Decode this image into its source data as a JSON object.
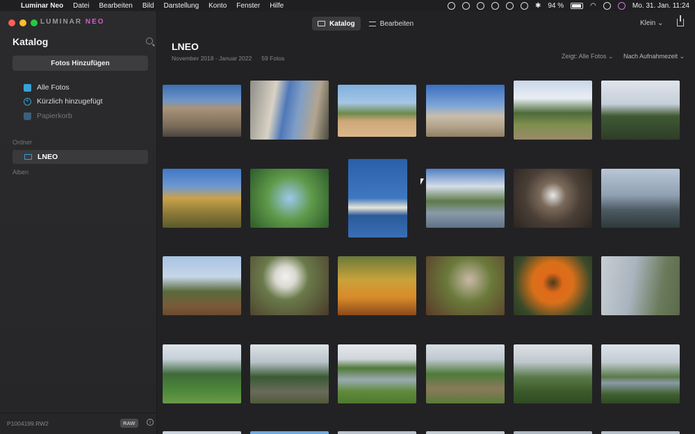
{
  "menubar": {
    "app": "Luminar Neo",
    "items": [
      "Datei",
      "Bearbeiten",
      "Bild",
      "Darstellung",
      "Konto",
      "Fenster",
      "Hilfe"
    ],
    "battery": "94 %",
    "datetime": "Mo. 31. Jan.  11:24"
  },
  "brand": {
    "name": "LUMINAR",
    "accent": "NEO"
  },
  "sidebar": {
    "title": "Katalog",
    "add_button": "Fotos Hinzufügen",
    "nav": [
      {
        "label": "Alle Fotos",
        "icon": "photos-icon"
      },
      {
        "label": "Kürzlich hinzugefügt",
        "icon": "recent-icon"
      },
      {
        "label": "Papierkorb",
        "icon": "trash-icon"
      }
    ],
    "folders_label": "Ordner",
    "folder": "LNEO",
    "albums_label": "Alben",
    "footer_filename": "P1004199.RW2",
    "footer_badge": "RAW"
  },
  "toolbar": {
    "tab_catalog": "Katalog",
    "tab_edit": "Bearbeiten",
    "size": "Klein ⌄"
  },
  "album": {
    "title": "LNEO",
    "daterange": "November 2018 - Januar 2022",
    "count": "59 Fotos",
    "filter": "Zeigt: Alle Fotos ⌄",
    "sort": "Nach Aufnahmezeit ⌄"
  },
  "colors": {
    "accent": "#3aa0d8",
    "neo": "#d35bd0"
  }
}
